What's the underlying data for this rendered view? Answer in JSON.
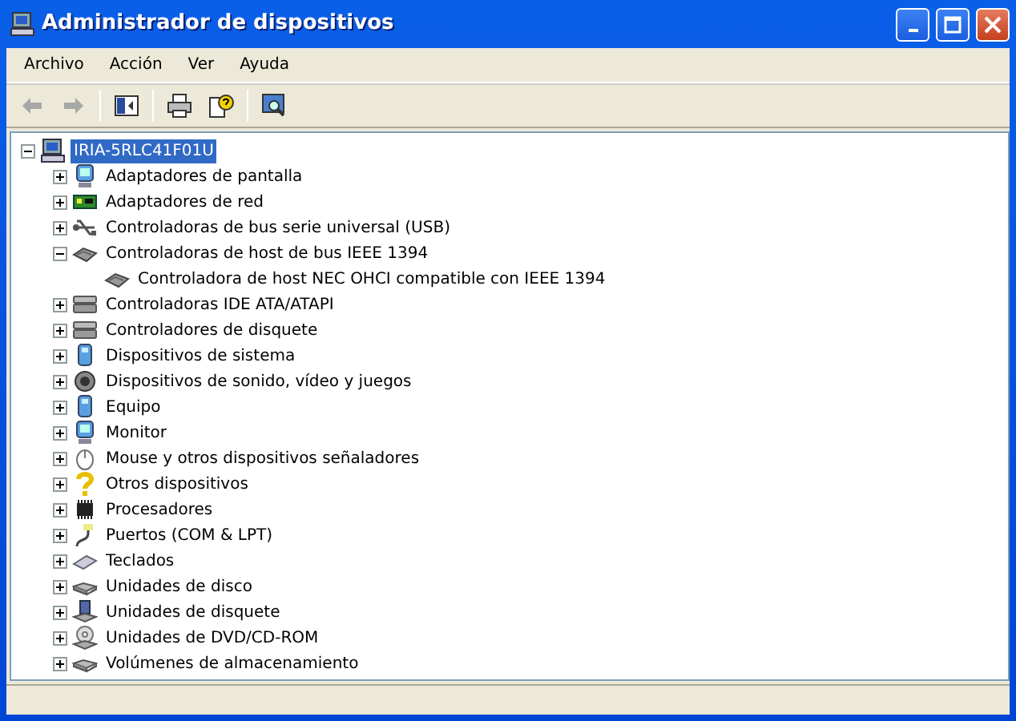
{
  "window": {
    "title": "Administrador de dispositivos"
  },
  "menu": [
    "Archivo",
    "Acción",
    "Ver",
    "Ayuda"
  ],
  "toolbar": [
    {
      "kind": "back",
      "disabled": true
    },
    {
      "kind": "forward",
      "disabled": true
    },
    {
      "kind": "tree",
      "disabled": false
    },
    {
      "kind": "print",
      "disabled": false
    },
    {
      "kind": "help",
      "disabled": false
    },
    {
      "kind": "scan",
      "disabled": false
    }
  ],
  "tree": {
    "label": "IRIA-5RLC41F01U",
    "kind": "computer",
    "selected": true,
    "expanded": true,
    "children": [
      {
        "label": "Adaptadores de pantalla",
        "kind": "display",
        "expanded": false
      },
      {
        "label": "Adaptadores de red",
        "kind": "network",
        "expanded": false
      },
      {
        "label": "Controladoras de bus serie universal (USB)",
        "kind": "usb",
        "expanded": false
      },
      {
        "label": "Controladoras de host de bus IEEE 1394",
        "kind": "card",
        "expanded": true,
        "children": [
          {
            "label": "Controladora de host NEC OHCI compatible con IEEE 1394",
            "kind": "card"
          }
        ]
      },
      {
        "label": "Controladoras IDE ATA/ATAPI",
        "kind": "ide",
        "expanded": false
      },
      {
        "label": "Controladores de disquete",
        "kind": "ide",
        "expanded": false
      },
      {
        "label": "Dispositivos de sistema",
        "kind": "system",
        "expanded": false
      },
      {
        "label": "Dispositivos de sonido, vídeo y juegos",
        "kind": "sound",
        "expanded": false
      },
      {
        "label": "Equipo",
        "kind": "system",
        "expanded": false
      },
      {
        "label": "Monitor",
        "kind": "display",
        "expanded": false
      },
      {
        "label": "Mouse y otros dispositivos señaladores",
        "kind": "mouse",
        "expanded": false
      },
      {
        "label": "Otros dispositivos",
        "kind": "unknown",
        "expanded": false
      },
      {
        "label": "Procesadores",
        "kind": "cpu",
        "expanded": false
      },
      {
        "label": "Puertos (COM & LPT)",
        "kind": "port",
        "expanded": false
      },
      {
        "label": "Teclados",
        "kind": "keyboard",
        "expanded": false
      },
      {
        "label": "Unidades de disco",
        "kind": "disk",
        "expanded": false
      },
      {
        "label": "Unidades de disquete",
        "kind": "floppy",
        "expanded": false
      },
      {
        "label": "Unidades de DVD/CD-ROM",
        "kind": "dvd",
        "expanded": false
      },
      {
        "label": "Volúmenes de almacenamiento",
        "kind": "disk",
        "expanded": false
      }
    ]
  }
}
